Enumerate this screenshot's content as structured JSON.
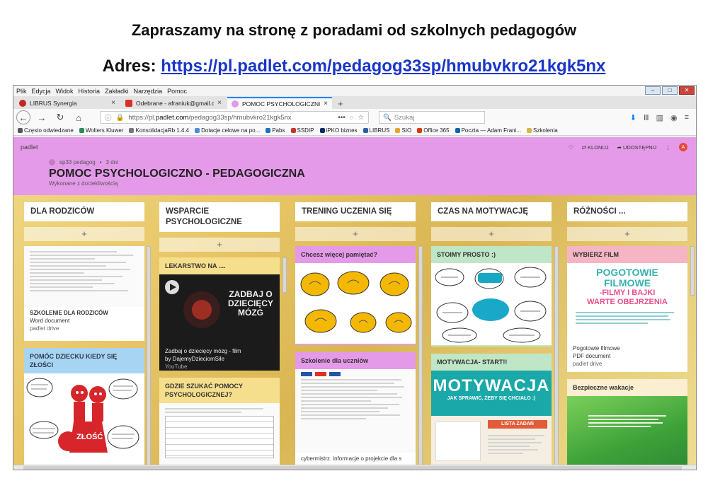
{
  "heading": {
    "line1": "Zapraszamy na stronę z poradami od szkolnych pedagogów",
    "address_label": "Adres:",
    "address_url": "https://pl.padlet.com/pedagog33sp/hmubvkro21kgk5nx"
  },
  "browser": {
    "menu": [
      "Plik",
      "Edycja",
      "Widok",
      "Historia",
      "Zakładki",
      "Narzędzia",
      "Pomoc"
    ],
    "tabs": [
      {
        "label": "LIBRUS Synergia",
        "color": "#c72525"
      },
      {
        "label": "Odebrane - afraniuk@gmail.co",
        "color": "#d93025"
      },
      {
        "label": "POMOC PSYCHOLOGICZNO - ...",
        "color": "#e59ae9"
      }
    ],
    "url_prefix": "https://pl.",
    "url_domain": "padlet.com",
    "url_path": "/pedagog33sp/hmubvkro21kgk5nx",
    "url_dots": "•••",
    "search_placeholder": "Szukaj",
    "bookmarks": [
      {
        "label": "Często odwiedzane",
        "color": "#555555"
      },
      {
        "label": "Wolters Kluwer",
        "color": "#2e8b57"
      },
      {
        "label": "KonsolidacjaRb 1.4.4",
        "color": "#777777"
      },
      {
        "label": "Dotacje celowe na po...",
        "color": "#4a90d9"
      },
      {
        "label": "Pabs",
        "color": "#1e73be"
      },
      {
        "label": "SSDIP",
        "color": "#c0392b"
      },
      {
        "label": "iPKO biznes",
        "color": "#0a2c67"
      },
      {
        "label": "LIBRUS",
        "color": "#2a5fa8"
      },
      {
        "label": "SIO",
        "color": "#e5a52d"
      },
      {
        "label": "Office 365",
        "color": "#d83b01"
      },
      {
        "label": "Poczta — Adam Frani...",
        "color": "#0a64ad"
      },
      {
        "label": "Szkolenia",
        "color": "#d9b44a"
      }
    ]
  },
  "padlet": {
    "logo": "padlet",
    "actions": {
      "like": "♡",
      "clone": "KLONUJ",
      "share": "UDOSTĘPNIJ",
      "more": "⋮",
      "avatar": "A"
    },
    "author": "sp33 pedagog",
    "age": "3 dni",
    "title": "POMOC PSYCHOLOGICZNO - PEDAGOGICZNA",
    "subtitle": "Wykonane z dociekliwością",
    "columns": [
      {
        "title": "DLA RODZICÓW"
      },
      {
        "title": "WSPARCIE PSYCHOLOGICZNE"
      },
      {
        "title": "TRENING UCZENIA SIĘ"
      },
      {
        "title": "CZAS NA MOTYWACJĘ"
      },
      {
        "title": "RÓŻNOŚCI ..."
      }
    ],
    "add_symbol": "+",
    "cards": {
      "c1a": {
        "title": "SZKOLENIE DLA RODZICÓW",
        "type": "Word document",
        "source": "padlet drive"
      },
      "c1b": {
        "title": "POMÓC DZIECKU KIEDY SIĘ ZŁOŚCI",
        "word": "ZŁOŚĆ"
      },
      "c2a": {
        "title": "LEKARSTWO NA ....",
        "video_title": "Zadbaj o dziecięcy mózg - film",
        "by": "by DajemyDzieciomSile",
        "source": "YouTube",
        "thumb_text": "ZADBAJ O DZIECIĘCY MÓZG"
      },
      "c2b": {
        "title": "GDZIE SZUKAĆ POMOCY PSYCHOLOGICZNEJ?"
      },
      "c3a": {
        "title": "Chcesz więcej pamiętać?"
      },
      "c3b": {
        "title": "Szkolenie dla uczniów",
        "caption": "cybermistrz. informacje o projekcie dla s"
      },
      "c4a": {
        "title": "STOIMY PROSTO :)"
      },
      "c4b": {
        "title": "MOTYWACJA- START!!",
        "big": "MOTYWACJA",
        "tagline": "JAK SPRAWIĆ, ŻEBY SIĘ CHCIAŁO :)",
        "list": "LISTA ZADAŃ"
      },
      "c5a": {
        "title": "WYBIERZ FILM",
        "headline1": "POGOTOWIE",
        "headline2": "FILMOWE",
        "headline3": "-FILMY I BAJKI",
        "headline4": "WARTE OBEJRZENIA",
        "name": "Pogotowie filmowe",
        "type": "PDF document",
        "source": "padlet drive"
      },
      "c5b": {
        "title": "Bezpieczne wakacje"
      }
    }
  },
  "colors": {
    "padlet_header": "#e59ae9",
    "accent_blue": "#1a35c8",
    "motywacja_cyan": "#1aa8a8",
    "pink_title": "#e84d8c"
  }
}
